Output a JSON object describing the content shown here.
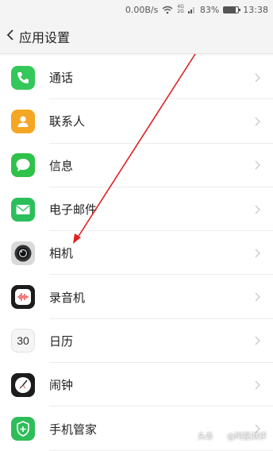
{
  "status_bar": {
    "speed": "0.00B/s",
    "network_top": "4G",
    "network_bottom": "2G",
    "battery_percent": "83%",
    "battery_level": 0.83,
    "time": "13:38"
  },
  "header": {
    "title": "应用设置",
    "back_icon": "chevron-left-icon"
  },
  "apps": [
    {
      "label": "通话",
      "icon": "phone-icon",
      "color": "#34c759"
    },
    {
      "label": "联系人",
      "icon": "contacts-icon",
      "color": "#f5a623"
    },
    {
      "label": "信息",
      "icon": "message-icon",
      "color": "#2fc24a"
    },
    {
      "label": "电子邮件",
      "icon": "mail-icon",
      "color": "#2bbf5b"
    },
    {
      "label": "相机",
      "icon": "camera-icon",
      "color": "#d9d9d9"
    },
    {
      "label": "录音机",
      "icon": "recorder-icon",
      "color": "#1c1c1c"
    },
    {
      "label": "日历",
      "icon": "calendar-icon",
      "color": "#f5f5f5",
      "icon_text": "30"
    },
    {
      "label": "闹钟",
      "icon": "clock-icon",
      "color": "#1c1c1c"
    },
    {
      "label": "手机管家",
      "icon": "shield-icon",
      "color": "#2ebd59"
    }
  ],
  "watermark": {
    "prefix": "头条",
    "handle": "@阿磊测评"
  },
  "colors": {
    "annotation_arrow": "#e02020"
  }
}
